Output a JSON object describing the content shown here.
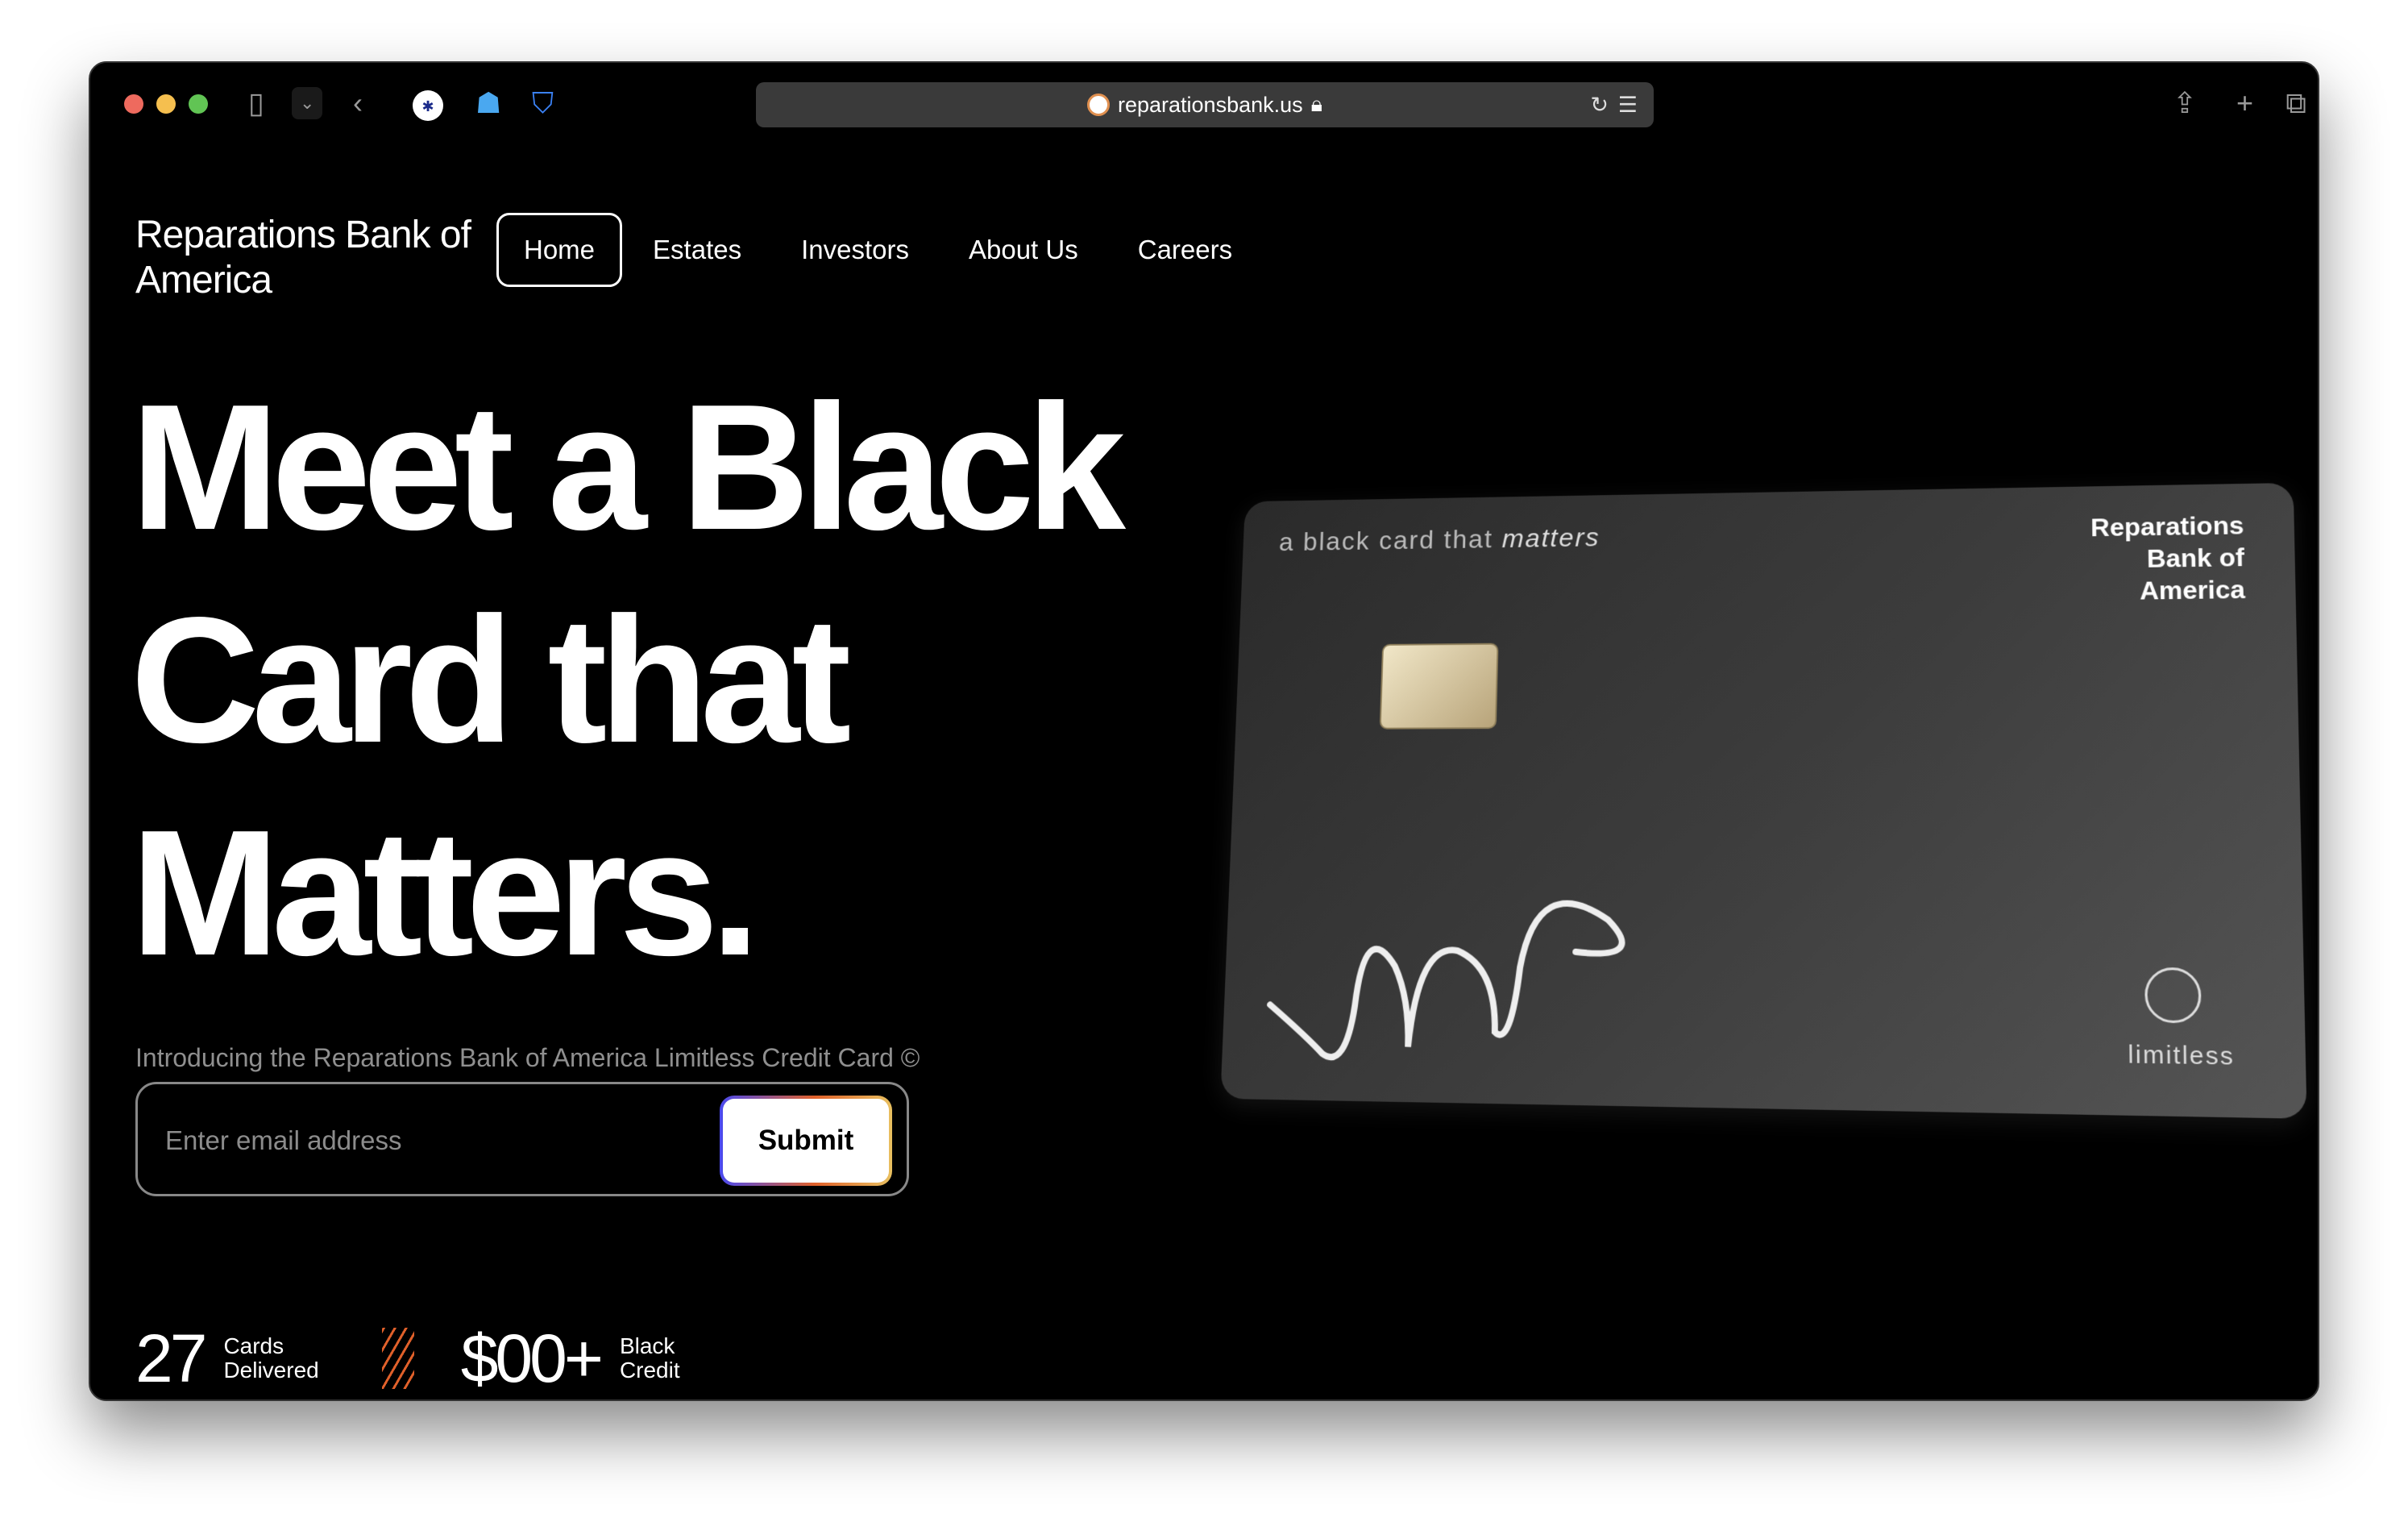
{
  "browser": {
    "url": "reparationsbank.us"
  },
  "site": {
    "logo": "Reparations Bank of America",
    "nav": [
      "Home",
      "Estates",
      "Investors",
      "About Us",
      "Careers"
    ],
    "headline": [
      "Meet a Black",
      "Card that",
      "Matters."
    ],
    "subtitle": "Introducing the Reparations Bank of America Limitless Credit Card ©",
    "email_placeholder": "Enter email address",
    "submit": "Submit",
    "stats": [
      {
        "value": "27",
        "label1": "Cards",
        "label2": "Delivered"
      },
      {
        "value": "$00+",
        "label1": "Black",
        "label2": "Credit"
      }
    ],
    "card": {
      "tag_prefix": "a black card that",
      "tag_emph": "matters",
      "brand": [
        "Reparations",
        "Bank of",
        "America"
      ],
      "limitless": "limitless"
    }
  }
}
